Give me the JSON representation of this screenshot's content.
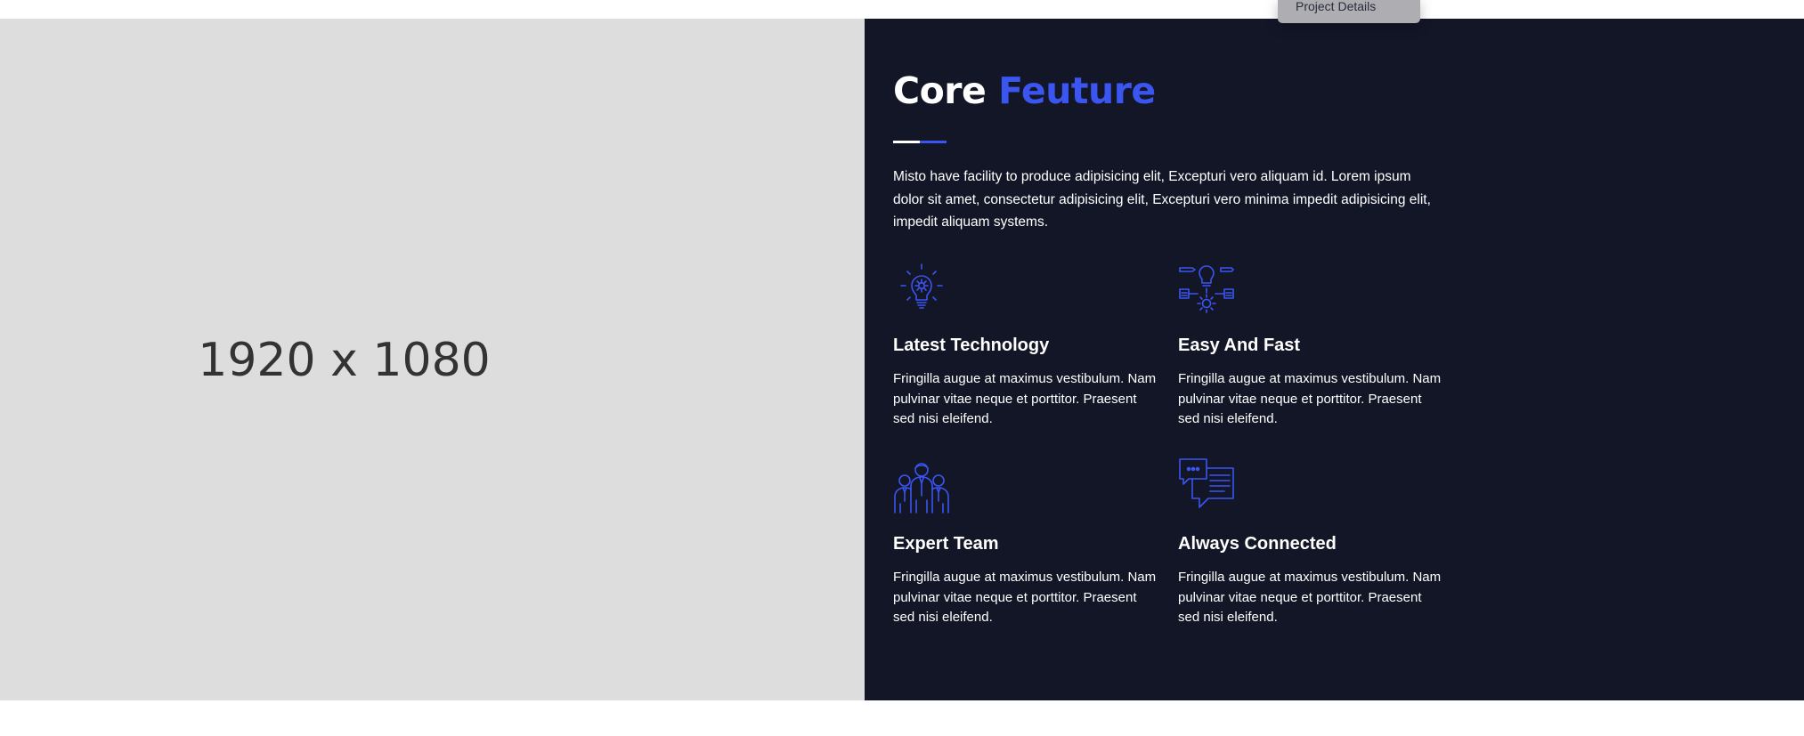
{
  "dropdown": {
    "label": "Project Details"
  },
  "placeholder": {
    "text": "1920 x 1080"
  },
  "heading": {
    "part1": "Core",
    "part2": "Feuture"
  },
  "intro": "Misto have facility to produce adipisicing elit, Excepturi vero aliquam id. Lorem ipsum dolor sit amet, consectetur adipisicing elit, Excepturi vero minima impedit adipisicing elit, impedit aliquam systems.",
  "features": [
    {
      "icon": "lightbulb-gear-icon",
      "title": "Latest Technology",
      "text": "Fringilla augue at maximus vestibulum. Nam pulvinar vitae neque et porttitor. Praesent sed nisi eleifend."
    },
    {
      "icon": "idea-process-icon",
      "title": "Easy And Fast",
      "text": "Fringilla augue at maximus vestibulum. Nam pulvinar vitae neque et porttitor. Praesent sed nisi eleifend."
    },
    {
      "icon": "team-icon",
      "title": "Expert Team",
      "text": "Fringilla augue at maximus vestibulum. Nam pulvinar vitae neque et porttitor. Praesent sed nisi eleifend."
    },
    {
      "icon": "chat-bubbles-icon",
      "title": "Always Connected",
      "text": "Fringilla augue at maximus vestibulum. Nam pulvinar vitae neque et porttitor. Praesent sed nisi eleifend."
    }
  ],
  "colors": {
    "accent": "#3a55f0",
    "dark_bg": "#131627",
    "placeholder_bg": "#dddddd"
  }
}
